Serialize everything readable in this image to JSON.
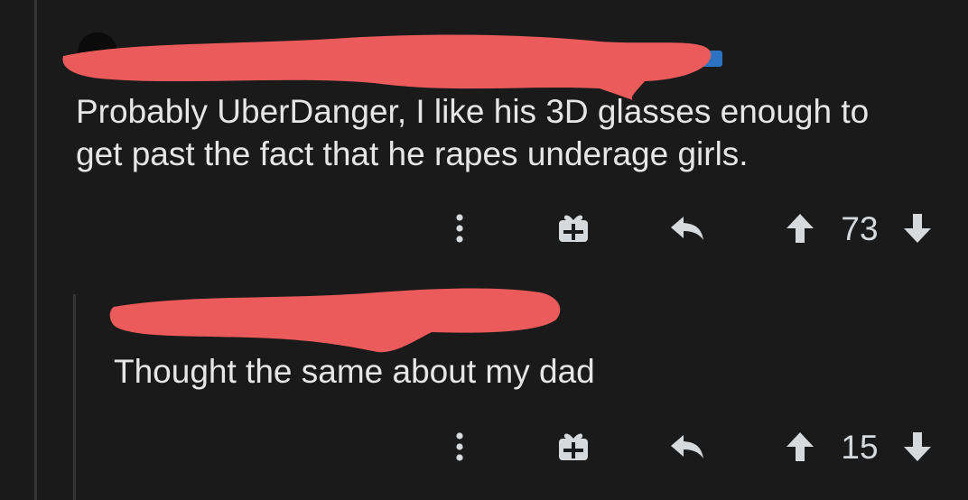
{
  "comment": {
    "text_line1": "Probably UberDanger, I like his 3D glasses enough to",
    "text_line2": "get past the fact that he rapes underage girls.",
    "actions": {
      "more_icon": "more-vertical-icon",
      "award_icon": "gift-icon",
      "reply_icon": "reply-arrow-icon",
      "upvote_icon": "arrow-up-icon",
      "downvote_icon": "arrow-down-icon",
      "score": "73"
    }
  },
  "reply": {
    "text": "Thought the same about my dad",
    "actions": {
      "more_icon": "more-vertical-icon",
      "award_icon": "gift-icon",
      "reply_icon": "reply-arrow-icon",
      "upvote_icon": "arrow-up-icon",
      "downvote_icon": "arrow-down-icon",
      "score": "15"
    }
  },
  "colors": {
    "background": "#1a1a1b",
    "text": "#e6e6e6",
    "icon": "#d7dadc",
    "thread_line": "#343536",
    "redaction": "#ec5b5b"
  }
}
